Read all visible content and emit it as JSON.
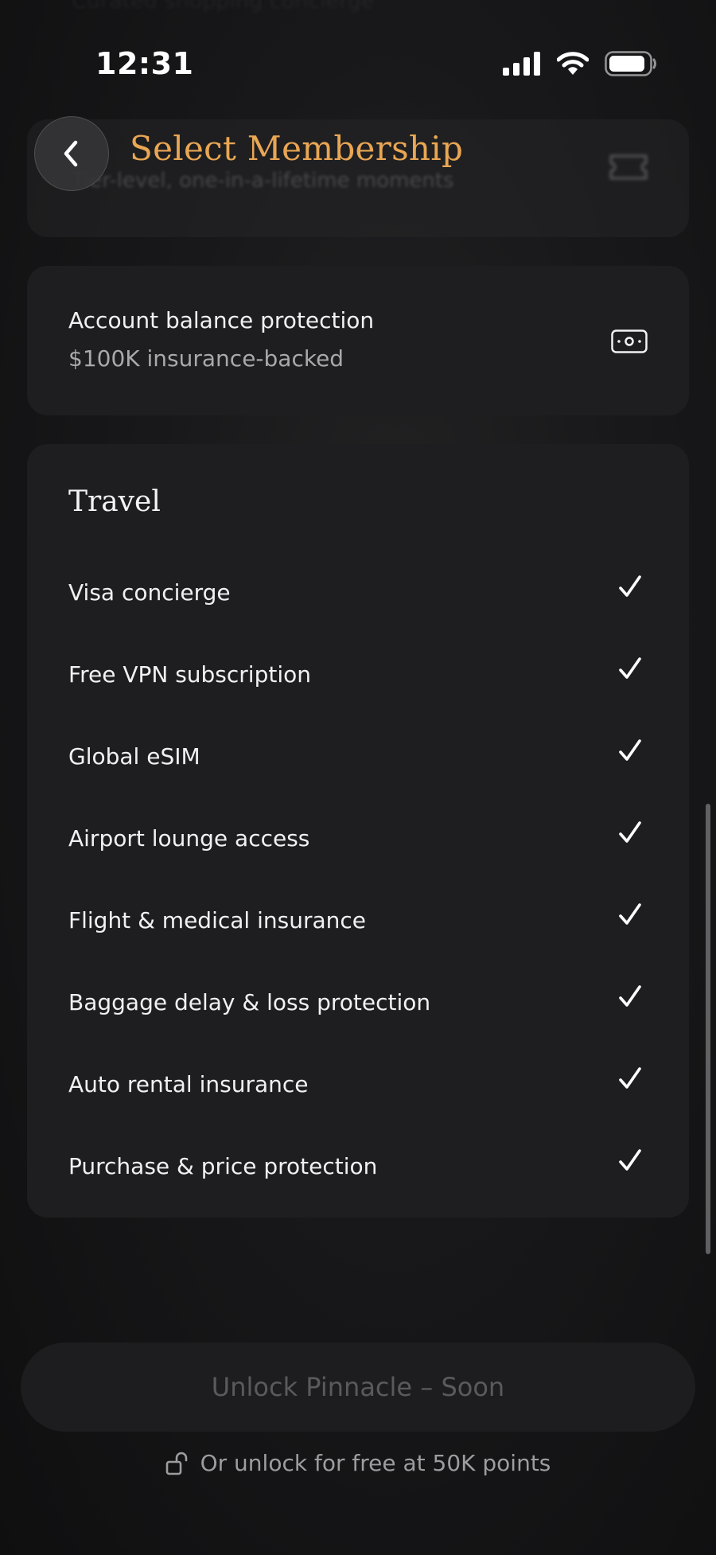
{
  "status_bar": {
    "time": "12:31",
    "icons": [
      "cellular-signal-icon",
      "wifi-icon",
      "battery-icon"
    ]
  },
  "background": {
    "partial_top_text": "Curated shopping concierge",
    "partial_card_subtitle": "Tier-level, one-in-a-lifetime moments",
    "partial_card_icon": "ticket-icon"
  },
  "header": {
    "back_icon": "chevron-left-icon",
    "title": "Select Membership"
  },
  "protection_card": {
    "title": "Account balance protection",
    "subtitle": "$100K insurance-backed",
    "icon": "cash-icon"
  },
  "travel": {
    "title": "Travel",
    "features": [
      {
        "label": "Visa concierge",
        "included": true
      },
      {
        "label": "Free VPN subscription",
        "included": true
      },
      {
        "label": "Global eSIM",
        "included": true
      },
      {
        "label": "Airport lounge access",
        "included": true
      },
      {
        "label": "Flight & medical insurance",
        "included": true
      },
      {
        "label": "Baggage delay & loss protection",
        "included": true
      },
      {
        "label": "Auto rental insurance",
        "included": true
      },
      {
        "label": "Purchase & price protection",
        "included": true
      }
    ]
  },
  "cta": {
    "button_label": "Unlock Pinnacle – Soon",
    "free_unlock_text": "Or unlock for free at 50K points",
    "free_unlock_icon": "unlock-icon"
  },
  "colors": {
    "accent_gold": "#e9a653",
    "card_bg": "#1e1e20",
    "disabled_text": "#5a5a5c"
  }
}
